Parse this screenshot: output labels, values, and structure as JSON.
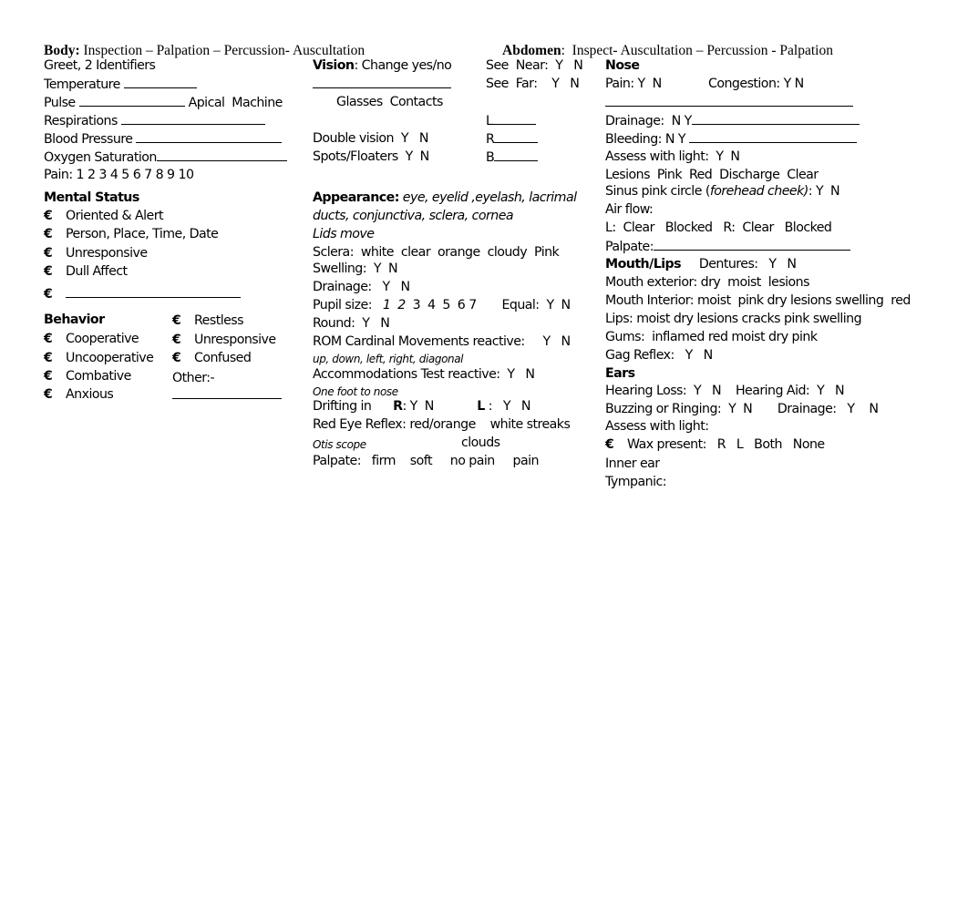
{
  "headers": {
    "body": {
      "label": "Body:",
      "text": " Inspection – Palpation – Percussion- Auscultation"
    },
    "abdomen": {
      "label": "Abdomen",
      "text": ":  Inspect- Auscultation – Percussion - Palpation"
    }
  },
  "vitals": {
    "greet": "Greet, 2 Identifiers",
    "temperature": "Temperature",
    "pulse": "Pulse",
    "pulse_options": "Apical  Machine",
    "respirations": "Respirations",
    "blood_pressure": "Blood Pressure",
    "oxygen": "Oxygen Saturation",
    "pain": "Pain: 1 2 3 4 5 6 7 8 9 10"
  },
  "mental_status": {
    "title": "Mental Status",
    "checkbox_glyph": "€",
    "items": [
      "Oriented & Alert",
      "Person, Place, Time, Date",
      "Unresponsive",
      "Dull Affect",
      ""
    ]
  },
  "behavior": {
    "title": "Behavior",
    "left_items": [
      "Cooperative",
      "Uncooperative",
      "Combative",
      "Anxious"
    ],
    "right_items": [
      "Restless",
      "Unresponsive",
      "Confused"
    ],
    "other": "Other:-"
  },
  "vision": {
    "label": "Vision",
    "text": ": Change yes/no",
    "glasses": "Glasses  Contacts",
    "double_vision": "Double vision  Y   N",
    "spots": "Spots/Floaters  Y  N",
    "see_near": "See  Near:  Y   N",
    "see_far": "See  Far:    Y   N",
    "L": "L",
    "R": "R",
    "B": "B"
  },
  "appearance": {
    "label": "Appearance:",
    "text_line1": " eye, eyelid ,eyelash, lacrimal",
    "text_line2": "ducts, conjunctiva, sclera, cornea",
    "lids": "Lids move",
    "sclera": "Sclera:  white  clear  orange  cloudy  Pink",
    "swelling": "Swelling:  Y  N",
    "drainage": "Drainage:   Y   N",
    "pupil_label": "Pupil size:   ",
    "pupil_italic": "1  2",
    "pupil_rest": "  3  4  5  6 7       Equal:  Y  N",
    "round": "Round:  Y   N",
    "rom": "ROM Cardinal Movements reactive:     Y   N",
    "rom_note": "up, down, left, right, diagonal",
    "accommodations": "Accommodations Test reactive:  Y   N",
    "accommodations_note": "One foot to nose",
    "drifting": "Drifting in      ",
    "drift_r_label": "R",
    "drift_r": ": Y  N            ",
    "drift_l_label": "L",
    "drift_l": " :   Y   N",
    "red_eye": "Red Eye Reflex: red/orange    white streaks",
    "otis": "Otis scope",
    "clouds": "clouds",
    "palpate": "Palpate:   firm    soft     no pain     pain"
  },
  "nose": {
    "title": "Nose",
    "pain": "Pain: Y  N",
    "congestion": "Congestion: Y N",
    "drainage": "Drainage:  N Y",
    "bleeding": "Bleeding: N Y ",
    "assess": "Assess with light:  Y  N",
    "lesions": "Lesions  Pink  Red  Discharge  Clear",
    "sinus_pre": "Sinus pink circle (",
    "sinus_italic": "forehead cheek)",
    "sinus_post": ": Y  N",
    "airflow": "Air flow:",
    "airflow_options": "L:  Clear   Blocked   R:  Clear   Blocked",
    "palpate": "Palpate:"
  },
  "mouth": {
    "title": "Mouth/Lips",
    "dentures": "     Dentures:   Y   N",
    "exterior": "Mouth exterior: dry  moist  lesions",
    "interior": "Mouth Interior: moist  pink dry lesions swelling  red",
    "lips": "Lips: moist dry lesions cracks pink swelling",
    "gums": "Gums:  inflamed red moist dry pink",
    "gag": "Gag Reflex:   Y   N"
  },
  "ears": {
    "title": "Ears",
    "hearing": "Hearing Loss:  Y   N    Hearing Aid:  Y   N",
    "buzzing": "Buzzing or Ringing:  Y  N       Drainage:   Y    N",
    "assess": "Assess with light:",
    "wax": "Wax present:   R   L   Both   None",
    "inner": "Inner ear",
    "tympanic": "Tympanic:"
  }
}
